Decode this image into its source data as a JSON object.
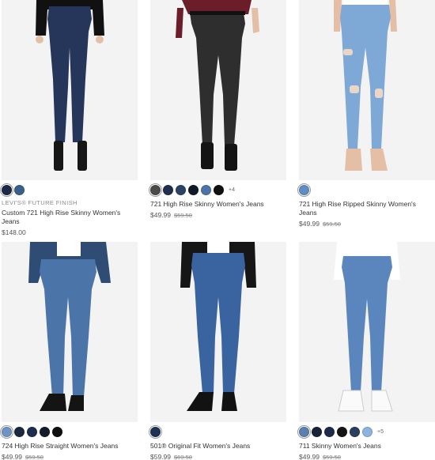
{
  "products": [
    {
      "swatches": [
        "#1d2a45",
        "#3a5f8a"
      ],
      "more": "",
      "finish_label": "LEVI'S® FUTURE FINISH",
      "name": "Custom 721 High Rise Skinny Women's Jeans",
      "price": "$148.00",
      "original_price": ""
    },
    {
      "swatches": [
        "#4a4a4a",
        "#1f2f4d",
        "#2c4366",
        "#121a2a",
        "#4c74a8",
        "#111111"
      ],
      "more": "+4",
      "finish_label": "",
      "name": "721 High Rise Skinny Women's Jeans",
      "price": "$49.99",
      "original_price": "$59.50"
    },
    {
      "swatches": [
        "#5f8cc2"
      ],
      "more": "",
      "finish_label": "",
      "name": "721 High Rise Ripped Skinny Women's Jeans",
      "price": "$49.99",
      "original_price": "$59.50"
    },
    {
      "swatches": [
        "#6f93c4",
        "#1a2840",
        "#1d2d4d",
        "#141c2c",
        "#0f0f0f"
      ],
      "more": "",
      "finish_label": "",
      "name": "724 High Rise Straight Women's Jeans",
      "price": "$49.99",
      "original_price": "$59.50"
    },
    {
      "swatches": [
        "#1f3253"
      ],
      "more": "",
      "finish_label": "",
      "name": "501® Original Fit Women's Jeans",
      "price": "$59.99",
      "original_price": "$69.50"
    },
    {
      "swatches": [
        "#5b7fae",
        "#18233a",
        "#1d2c4a",
        "#141414",
        "#2b3e5e",
        "#8eb3e0"
      ],
      "more": "+5",
      "finish_label": "",
      "name": "711 Skinny Women's Jeans",
      "price": "$49.99",
      "original_price": "$59.50"
    }
  ],
  "icons": {
    "product_images": [
      "product-photo-icon"
    ]
  }
}
